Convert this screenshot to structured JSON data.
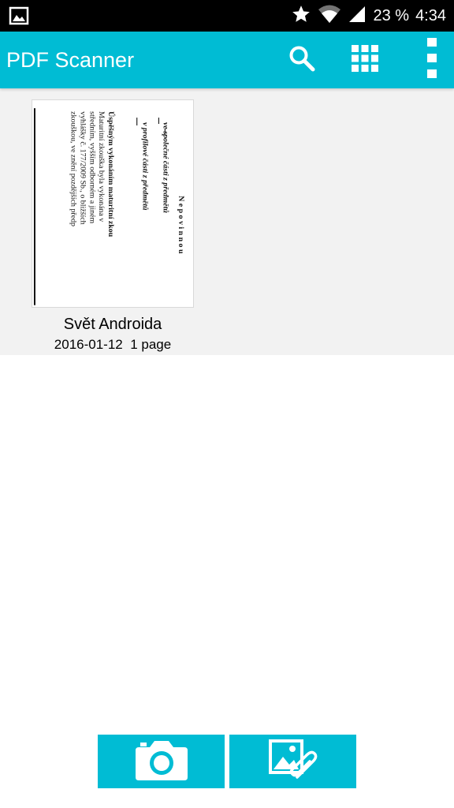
{
  "status_bar": {
    "left_icon": "image-notification-icon",
    "icons": [
      "star-icon",
      "wifi-icon",
      "signal-icon"
    ],
    "battery": "23 %",
    "time": "4:34"
  },
  "app_bar": {
    "title": "PDF Scanner",
    "actions": [
      "search-icon",
      "grid-view-icon",
      "more-vert-icon"
    ],
    "color": "#00BCD4"
  },
  "documents": [
    {
      "title": "Svět Androida",
      "meta": "2016-01-12  1 page",
      "thumbnail_text": [
        "N e p o v i n n o u",
        "ve společné části z předmětů",
        "v profilové části z předmětů",
        "Úspěšným vykonáním maturitní zkou",
        "Maturitní zkouška byla vykonána v",
        "středním, vyšším odborném a jiném",
        "vyhlášky č. 177/2009 Sb., o bližších",
        "zkouškou, ve znění pozdějších předp"
      ]
    }
  ],
  "bottom_actions": [
    "camera-icon",
    "gallery-attach-icon"
  ]
}
